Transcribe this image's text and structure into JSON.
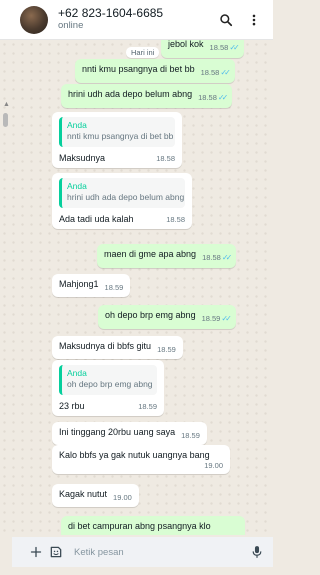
{
  "header": {
    "contact": "+62 823-1604-6685",
    "status": "online"
  },
  "date_chip": "Hari ini",
  "messages": [
    {
      "text": "jebol kok",
      "time": "18.58",
      "dir": "out"
    },
    {
      "text": "nnti kmu psangnya di bet bb",
      "time": "18.58",
      "dir": "out"
    },
    {
      "text": "hrini udh ada depo belum abng",
      "time": "18.58",
      "dir": "out"
    },
    {
      "quote_name": "Anda",
      "quote_text": "nnti kmu psangnya di bet bb",
      "text": "Maksudnya",
      "time": "18.58",
      "dir": "in"
    },
    {
      "quote_name": "Anda",
      "quote_text": "hrini udh ada depo belum abng",
      "text": "Ada tadi uda kalah",
      "time": "18.58",
      "dir": "in"
    },
    {
      "text": "maen di gme apa abng",
      "time": "18.58",
      "dir": "out"
    },
    {
      "text": "Mahjong1",
      "time": "18.59",
      "dir": "in"
    },
    {
      "text": "oh depo brp emg abng",
      "time": "18.59",
      "dir": "out"
    },
    {
      "text": "Maksudnya di bbfs gitu",
      "time": "18.59",
      "dir": "in"
    },
    {
      "quote_name": "Anda",
      "quote_text": "oh depo brp emg abng",
      "text": "23 rbu",
      "time": "18.59",
      "dir": "in"
    },
    {
      "text": "Ini tinggang 20rbu uang saya",
      "time": "18.59",
      "dir": "in"
    },
    {
      "text": "Kalo bbfs ya gak nutuk uangnya bang",
      "time": "19.00",
      "dir": "in"
    },
    {
      "text": "Kagak nutut",
      "time": "19.00",
      "dir": "in"
    },
    {
      "text": "di bet campuran abng psangnya klo",
      "dir": "out"
    }
  ],
  "composer": {
    "placeholder": "Ketik pesan"
  },
  "colors": {
    "outgoing_bubble": "#d9fdd3",
    "incoming_bubble": "#ffffff",
    "quote_accent": "#06cf9c",
    "read_ticks": "#53bdeb"
  },
  "icons": [
    "search-icon",
    "more-vertical-icon",
    "plus-icon",
    "sticker-icon",
    "microphone-icon",
    "double-check-icon"
  ]
}
